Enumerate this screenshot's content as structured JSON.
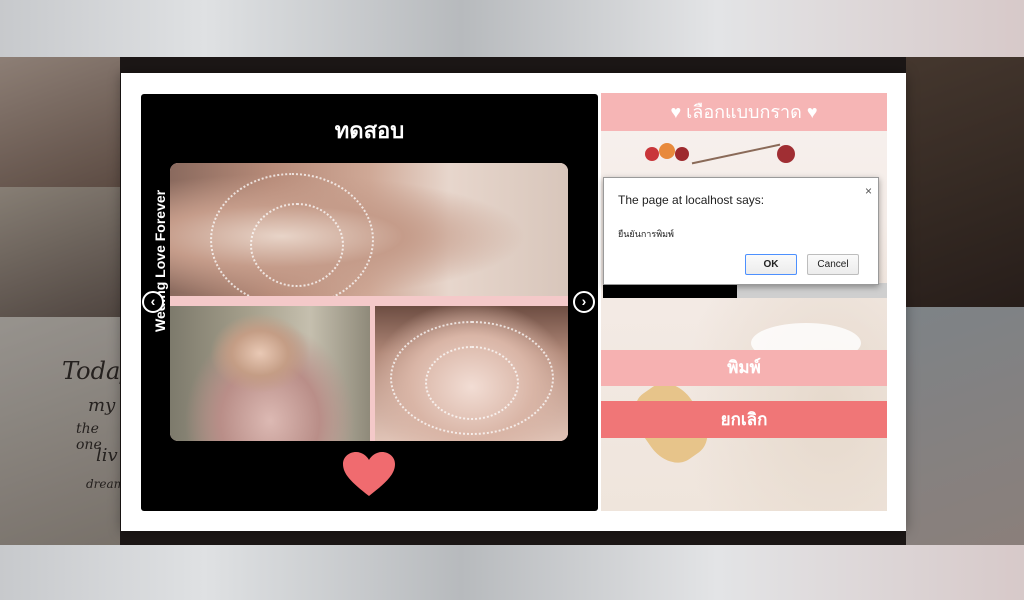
{
  "background": {
    "notes": [
      "Today",
      "my",
      "the one",
      "liv",
      "dream"
    ]
  },
  "card": {
    "title": "ทดสอบ",
    "side_text": "Weding Love Forever",
    "prev_label": "‹",
    "next_label": "›"
  },
  "panel": {
    "choose_label": "♥ เลือกแบบกราด ♥",
    "print_label": "พิมพ์",
    "cancel_label": "ยกเลิก"
  },
  "dialog": {
    "title": "The page at localhost says:",
    "message": "ยืนยันการพิมพ์",
    "close_label": "×",
    "ok_label": "OK",
    "cancel_label": "Cancel"
  },
  "colors": {
    "accent_pink": "#f6b5b5",
    "cancel_red": "#f07677",
    "heart": "#f06b6f"
  }
}
